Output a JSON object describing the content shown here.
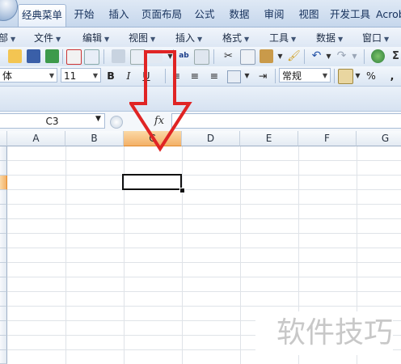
{
  "tabs": [
    {
      "label": "经典菜单",
      "active": true
    },
    {
      "label": "开始"
    },
    {
      "label": "插入"
    },
    {
      "label": "页面布局"
    },
    {
      "label": "公式"
    },
    {
      "label": "数据"
    },
    {
      "label": "审阅"
    },
    {
      "label": "视图"
    },
    {
      "label": "开发工具"
    },
    {
      "label": "Acrob"
    }
  ],
  "menus": [
    "部",
    "文件",
    "编辑",
    "视图",
    "插入",
    "格式",
    "工具",
    "数据",
    "窗口"
  ],
  "format_bar": {
    "font_name": "体",
    "font_size": "11",
    "bold": "B",
    "italic": "I",
    "number_format": "常规",
    "percent": "%",
    "comma": ","
  },
  "formula_bar": {
    "name_box": "C3",
    "fx_label": "fx",
    "formula": ""
  },
  "columns": [
    "A",
    "B",
    "C",
    "D",
    "E",
    "F",
    "G"
  ],
  "selected_column": "C",
  "watermark": "软件技巧",
  "colors": {
    "selection_header": "#f3b067",
    "annotation_arrow": "#e02424",
    "ribbon": "#c6d7ec"
  }
}
